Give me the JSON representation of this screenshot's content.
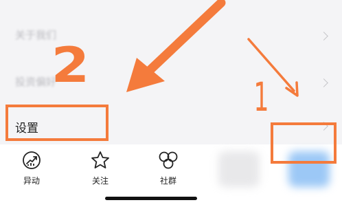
{
  "settings_list": {
    "items": [
      {
        "label": "关于我们"
      },
      {
        "label": "投资偏好"
      },
      {
        "label": "设置"
      }
    ]
  },
  "annotations": {
    "step_1": "1",
    "step_2": "2",
    "color": "#f47b3c"
  },
  "tabbar": {
    "items": [
      {
        "label": "异动",
        "icon": "chart-trend-icon"
      },
      {
        "label": "关注",
        "icon": "star-icon"
      },
      {
        "label": "社群",
        "icon": "bubbles-icon"
      }
    ]
  }
}
